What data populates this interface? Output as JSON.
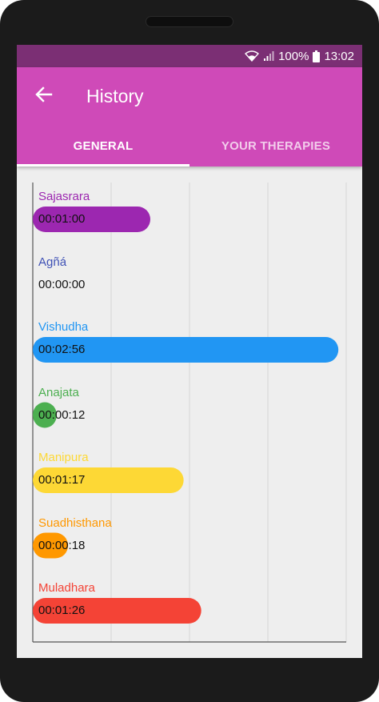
{
  "status_bar": {
    "battery_percent": "100%",
    "time": "13:02"
  },
  "app_bar": {
    "title": "History",
    "back_icon": "arrow-left-icon"
  },
  "tabs": [
    {
      "label": "GENERAL",
      "active": true
    },
    {
      "label": "YOUR THERAPIES",
      "active": false
    }
  ],
  "chart_data": {
    "type": "bar",
    "orientation": "horizontal",
    "grid": true,
    "xlim": [
      0,
      160
    ],
    "categories": [
      "Sajasrara",
      "Agñá",
      "Vishudha",
      "Anajata",
      "Manipura",
      "Suadhisthana",
      "Muladhara"
    ],
    "values": [
      60,
      0,
      156,
      12,
      77,
      18,
      86
    ],
    "value_labels": [
      "00:01:00",
      "00:00:00",
      "00:02:56",
      "00:00:12",
      "00:01:17",
      "00:00:18",
      "00:01:26"
    ],
    "colors": [
      "#9c27b0",
      "#3f51b5",
      "#2196f3",
      "#4caf50",
      "#fdd835",
      "#ff9800",
      "#f44336"
    ]
  }
}
